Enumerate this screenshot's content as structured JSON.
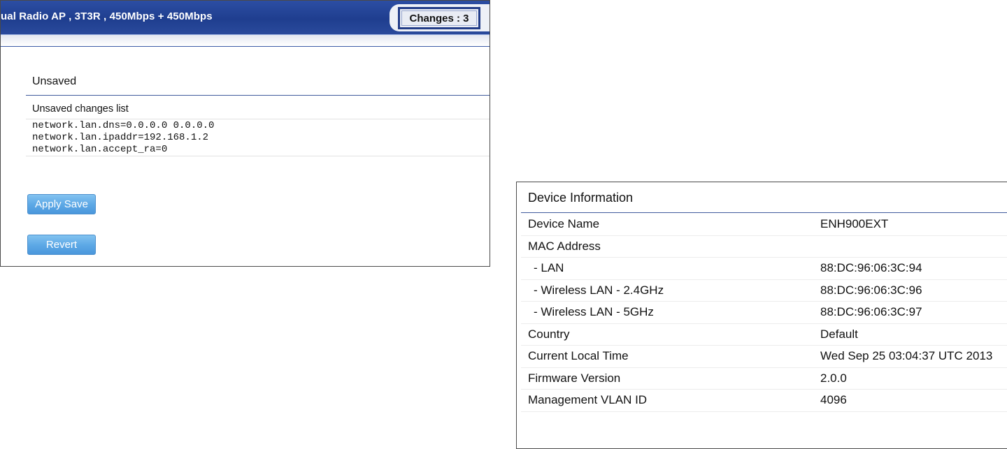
{
  "header": {
    "title": "ual Radio AP , 3T3R , 450Mbps + 450Mbps",
    "changes_label": "Changes : 3"
  },
  "unsaved": {
    "section_title": "Unsaved",
    "list_label": "Unsaved changes list",
    "changes": [
      "network.lan.dns=0.0.0.0 0.0.0.0",
      "network.lan.ipaddr=192.168.1.2",
      "network.lan.accept_ra=0"
    ],
    "apply_button": "Apply Save",
    "revert_button": "Revert"
  },
  "device_info": {
    "title": "Device Information",
    "rows": [
      {
        "label": "Device Name",
        "value": "ENH900EXT"
      },
      {
        "label": "MAC Address",
        "value": ""
      },
      {
        "label": "- LAN",
        "value": "88:DC:96:06:3C:94"
      },
      {
        "label": "- Wireless LAN - 2.4GHz",
        "value": "88:DC:96:06:3C:96"
      },
      {
        "label": "- Wireless LAN - 5GHz",
        "value": "88:DC:96:06:3C:97"
      },
      {
        "label": "Country",
        "value": "Default"
      },
      {
        "label": "Current Local Time",
        "value": "Wed Sep 25 03:04:37 UTC 2013"
      },
      {
        "label": "Firmware Version",
        "value": "2.0.0"
      },
      {
        "label": "Management VLAN ID",
        "value": "4096"
      }
    ]
  },
  "colors": {
    "header_blue": "#1f3e8f",
    "button_blue": "#5ea9e6",
    "rule_blue": "#3f5a9c"
  }
}
